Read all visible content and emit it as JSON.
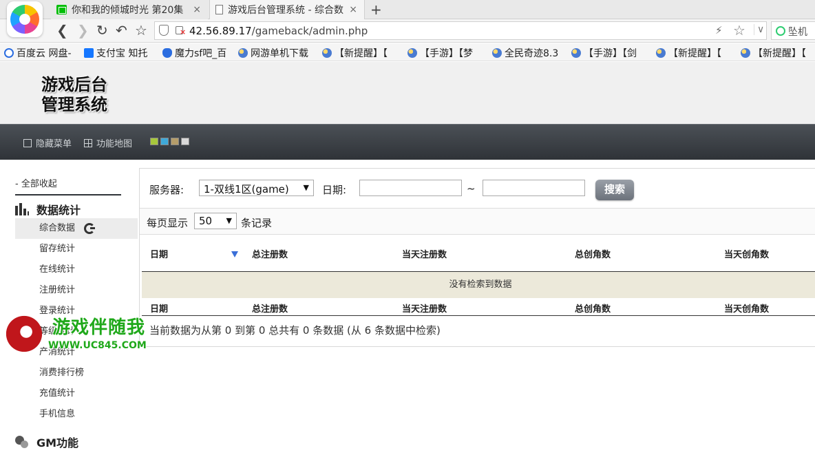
{
  "browser": {
    "tabs": [
      {
        "label": "你和我的倾城时光 第20集",
        "icon": "iqiyi-icon"
      },
      {
        "label": "游戏后台管理系统 - 综合数",
        "icon": "page-icon"
      }
    ],
    "close_glyph": "×",
    "new_tab_glyph": "+",
    "url_host": "42.56.89.17",
    "url_path": "/gameback/admin.php",
    "search_text": "坠机",
    "bookmarks": [
      {
        "label": "百度云 网盘-",
        "icon": "baidu-icon"
      },
      {
        "label": "支付宝 知托",
        "icon": "alipay-icon"
      },
      {
        "label": "魔力sf吧_百",
        "icon": "paw-icon"
      },
      {
        "label": "网游单机下载",
        "icon": "ball-icon"
      },
      {
        "label": "【新提醒】【",
        "icon": "ball-icon"
      },
      {
        "label": "【手游】【梦",
        "icon": "ball-icon"
      },
      {
        "label": "全民奇迹8.3",
        "icon": "ball-icon"
      },
      {
        "label": "【手游】【剑",
        "icon": "ball-icon"
      },
      {
        "label": "【新提醒】【",
        "icon": "ball-icon"
      },
      {
        "label": "【新提醒】【",
        "icon": "ball-icon"
      }
    ]
  },
  "header": {
    "logo_line1": "游戏后台",
    "logo_line2": "管理系统"
  },
  "menubar": {
    "hide_menu": "隐藏菜单",
    "function_map": "功能地图",
    "swatch_colors": [
      "#a8c83c",
      "#3fa9d9",
      "#b59d6a",
      "#d9d9d9"
    ]
  },
  "sidebar": {
    "collapse_all": "- 全部收起",
    "section1": "数据统计",
    "items": [
      "综合数据",
      "留存统计",
      "在线统计",
      "注册统计",
      "登录统计",
      "等级统计",
      "产消统计",
      "消费排行榜",
      "充值统计",
      "手机信息"
    ],
    "section2": "GM功能"
  },
  "filter": {
    "server_label": "服务器:",
    "server_value": "1-双线1区(game)",
    "date_label": "日期:",
    "date_from": "",
    "date_to": "",
    "tilde": "~",
    "search_button": "搜索"
  },
  "pager": {
    "show_label": "每页显示",
    "page_size": "50",
    "records_label": "条记录"
  },
  "table": {
    "columns": [
      "日期",
      "总注册数",
      "当天注册数",
      "总创角数",
      "当天创角数"
    ],
    "empty_text": "没有检索到数据",
    "info": "当前数据为从第 0 到第 0 总共有 0 条数据 (从 6 条数据中检索)"
  },
  "watermark": {
    "title": "游戏伴随我",
    "url": "WWW.UC845.COM"
  }
}
